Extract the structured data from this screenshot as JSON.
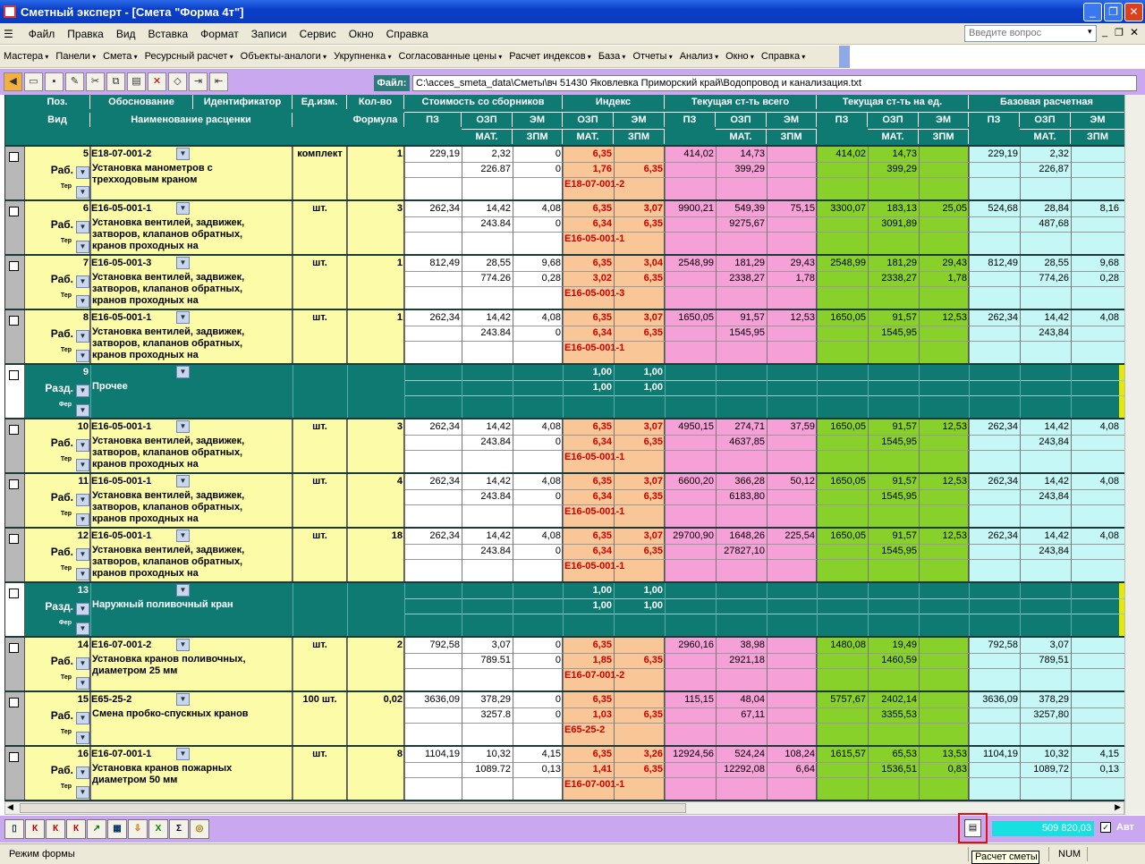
{
  "title": "Сметный эксперт - [Смета \"Форма 4т\"]",
  "menu": [
    "Файл",
    "Правка",
    "Вид",
    "Вставка",
    "Формат",
    "Записи",
    "Сервис",
    "Окно",
    "Справка"
  ],
  "ask_placeholder": "Введите вопрос",
  "toolbar2": [
    "Мастера",
    "Панели",
    "Смета",
    "Ресурсный расчет",
    "Объекты-аналоги",
    "Укрупненка",
    "Согласованные цены",
    "Расчет индексов",
    "База",
    "Отчеты",
    "Анализ",
    "Окно",
    "Справка"
  ],
  "file_label": "Файл:",
  "file_path": "C:\\acces_smeta_data\\Сметы\\вч 51430 Яковлевка Приморский край\\Водопровод и канализация.txt",
  "header": {
    "pos": "Поз.",
    "vid": "Вид",
    "obosn": "Обоснование",
    "ident": "Идентификатор",
    "name": "Наименование расценки",
    "unit": "Ед.изм.",
    "qty": "Кол-во",
    "formula": "Формула",
    "g1": "Стоимость со сборников",
    "g2": "Индекс",
    "g3": "Текущая ст-ть всего",
    "g4": "Текущая ст-ть на ед.",
    "g5": "Базовая расчетная",
    "pz": "ПЗ",
    "ozp": "ОЗП",
    "em": "ЭМ",
    "mat": "МАТ.",
    "zpm": "ЗПМ"
  },
  "rows": [
    {
      "type": "rab",
      "pos": "5",
      "code": "Е18-07-001-2",
      "vid": "Раб.",
      "name": [
        "Установка манометров с",
        "трехходовым краном"
      ],
      "unit": "комплект",
      "qty": "1",
      "s": [
        "229,19",
        "2,32",
        "0",
        "226.87",
        "0"
      ],
      "i": [
        "6,35",
        "",
        "1,76",
        "6,35"
      ],
      "icode": "Е18-07-001-2",
      "t": [
        "414,02",
        "14,73",
        "",
        "399,29",
        ""
      ],
      "u": [
        "414,02",
        "14,73",
        "",
        "399,29",
        ""
      ],
      "bz": [
        "229,19",
        "2,32",
        "",
        "226,87",
        ""
      ]
    },
    {
      "type": "rab",
      "pos": "6",
      "code": "Е16-05-001-1",
      "vid": "Раб.",
      "name": [
        "Установка вентилей, задвижек,",
        "затворов, клапанов обратных,",
        "кранов проходных на"
      ],
      "unit": "шт.",
      "qty": "3",
      "s": [
        "262,34",
        "14,42",
        "4,08",
        "243.84",
        "0"
      ],
      "i": [
        "6,35",
        "3,07",
        "6,34",
        "6,35"
      ],
      "icode": "Е16-05-001-1",
      "t": [
        "9900,21",
        "549,39",
        "75,15",
        "9275,67",
        ""
      ],
      "u": [
        "3300,07",
        "183,13",
        "25,05",
        "3091,89",
        ""
      ],
      "bz": [
        "524,68",
        "28,84",
        "8,16",
        "487,68",
        ""
      ]
    },
    {
      "type": "rab",
      "pos": "7",
      "code": "Е16-05-001-3",
      "vid": "Раб.",
      "name": [
        "Установка вентилей, задвижек,",
        "затворов, клапанов обратных,",
        "кранов проходных на"
      ],
      "unit": "шт.",
      "qty": "1",
      "s": [
        "812,49",
        "28,55",
        "9,68",
        "774.26",
        "0,28"
      ],
      "i": [
        "6,35",
        "3,04",
        "3,02",
        "6,35"
      ],
      "icode": "Е16-05-001-3",
      "t": [
        "2548,99",
        "181,29",
        "29,43",
        "2338,27",
        "1,78"
      ],
      "u": [
        "2548,99",
        "181,29",
        "29,43",
        "2338,27",
        "1,78"
      ],
      "bz": [
        "812,49",
        "28,55",
        "9,68",
        "774,26",
        "0,28"
      ]
    },
    {
      "type": "rab",
      "pos": "8",
      "code": "Е16-05-001-1",
      "vid": "Раб.",
      "name": [
        "Установка вентилей, задвижек,",
        "затворов, клапанов обратных,",
        "кранов проходных на"
      ],
      "unit": "шт.",
      "qty": "1",
      "s": [
        "262,34",
        "14,42",
        "4,08",
        "243.84",
        "0"
      ],
      "i": [
        "6,35",
        "3,07",
        "6,34",
        "6,35"
      ],
      "icode": "Е16-05-001-1",
      "t": [
        "1650,05",
        "91,57",
        "12,53",
        "1545,95",
        ""
      ],
      "u": [
        "1650,05",
        "91,57",
        "12,53",
        "1545,95",
        ""
      ],
      "bz": [
        "262,34",
        "14,42",
        "4,08",
        "243,84",
        ""
      ]
    },
    {
      "type": "sec",
      "pos": "9",
      "vid": "Разд.",
      "name": [
        "Прочее"
      ],
      "i": [
        "1,00",
        "1,00",
        "1,00",
        "1,00"
      ]
    },
    {
      "type": "rab",
      "pos": "10",
      "code": "Е16-05-001-1",
      "vid": "Раб.",
      "name": [
        "Установка вентилей, задвижек,",
        "затворов, клапанов обратных,",
        "кранов проходных на"
      ],
      "unit": "шт.",
      "qty": "3",
      "s": [
        "262,34",
        "14,42",
        "4,08",
        "243.84",
        "0"
      ],
      "i": [
        "6,35",
        "3,07",
        "6,34",
        "6,35"
      ],
      "icode": "Е16-05-001-1",
      "t": [
        "4950,15",
        "274,71",
        "37,59",
        "4637,85",
        ""
      ],
      "u": [
        "1650,05",
        "91,57",
        "12,53",
        "1545,95",
        ""
      ],
      "bz": [
        "262,34",
        "14,42",
        "4,08",
        "243,84",
        ""
      ]
    },
    {
      "type": "rab",
      "pos": "11",
      "code": "Е16-05-001-1",
      "vid": "Раб.",
      "name": [
        "Установка вентилей, задвижек,",
        "затворов, клапанов обратных,",
        "кранов проходных на"
      ],
      "unit": "шт.",
      "qty": "4",
      "s": [
        "262,34",
        "14,42",
        "4,08",
        "243.84",
        "0"
      ],
      "i": [
        "6,35",
        "3,07",
        "6,34",
        "6,35"
      ],
      "icode": "Е16-05-001-1",
      "t": [
        "6600,20",
        "366,28",
        "50,12",
        "6183,80",
        ""
      ],
      "u": [
        "1650,05",
        "91,57",
        "12,53",
        "1545,95",
        ""
      ],
      "bz": [
        "262,34",
        "14,42",
        "4,08",
        "243,84",
        ""
      ]
    },
    {
      "type": "rab",
      "pos": "12",
      "code": "Е16-05-001-1",
      "vid": "Раб.",
      "name": [
        "Установка вентилей, задвижек,",
        "затворов, клапанов обратных,",
        "кранов проходных на"
      ],
      "unit": "шт.",
      "qty": "18",
      "s": [
        "262,34",
        "14,42",
        "4,08",
        "243.84",
        "0"
      ],
      "i": [
        "6,35",
        "3,07",
        "6,34",
        "6,35"
      ],
      "icode": "Е16-05-001-1",
      "t": [
        "29700,90",
        "1648,26",
        "225,54",
        "27827,10",
        ""
      ],
      "u": [
        "1650,05",
        "91,57",
        "12,53",
        "1545,95",
        ""
      ],
      "bz": [
        "262,34",
        "14,42",
        "4,08",
        "243,84",
        ""
      ]
    },
    {
      "type": "sec",
      "pos": "13",
      "vid": "Разд.",
      "name": [
        "Наружный поливочный кран"
      ],
      "i": [
        "1,00",
        "1,00",
        "1,00",
        "1,00"
      ]
    },
    {
      "type": "rab",
      "pos": "14",
      "code": "Е16-07-001-2",
      "vid": "Раб.",
      "name": [
        "Установка кранов поливочных,",
        "диаметром 25 мм"
      ],
      "unit": "шт.",
      "qty": "2",
      "s": [
        "792,58",
        "3,07",
        "0",
        "789.51",
        "0"
      ],
      "i": [
        "6,35",
        "",
        "1,85",
        "6,35"
      ],
      "icode": "Е16-07-001-2",
      "t": [
        "2960,16",
        "38,98",
        "",
        "2921,18",
        ""
      ],
      "u": [
        "1480,08",
        "19,49",
        "",
        "1460,59",
        ""
      ],
      "bz": [
        "792,58",
        "3,07",
        "",
        "789,51",
        ""
      ]
    },
    {
      "type": "rab",
      "pos": "15",
      "code": "Е65-25-2",
      "vid": "Раб.",
      "name": [
        "Смена пробко-спускных кранов"
      ],
      "unit": "100 шт.",
      "qty": "0,02",
      "s": [
        "3636,09",
        "378,29",
        "0",
        "3257.8",
        "0"
      ],
      "i": [
        "6,35",
        "",
        "1,03",
        "6,35"
      ],
      "icode": "Е65-25-2",
      "t": [
        "115,15",
        "48,04",
        "",
        "67,11",
        ""
      ],
      "u": [
        "5757,67",
        "2402,14",
        "",
        "3355,53",
        ""
      ],
      "bz": [
        "3636,09",
        "378,29",
        "",
        "3257,80",
        ""
      ]
    },
    {
      "type": "rab",
      "pos": "16",
      "code": "Е16-07-001-1",
      "vid": "Раб.",
      "name": [
        "Установка кранов пожарных",
        "диаметром 50 мм"
      ],
      "unit": "шт.",
      "qty": "8",
      "s": [
        "1104,19",
        "10,32",
        "4,15",
        "1089.72",
        "0,13"
      ],
      "i": [
        "6,35",
        "3,26",
        "1,41",
        "6,35"
      ],
      "icode": "Е16-07-001-1",
      "t": [
        "12924,56",
        "524,24",
        "108,24",
        "12292,08",
        "6,64"
      ],
      "u": [
        "1615,57",
        "65,53",
        "13,53",
        "1536,51",
        "0,83"
      ],
      "bz": [
        "1104,19",
        "10,32",
        "4,15",
        "1089,72",
        "0,13"
      ]
    }
  ],
  "small_labels": {
    "ter": "Тер",
    "fer": "Фер"
  },
  "total": "509 820,03",
  "avt": "Авт",
  "status": "Режим формы",
  "num": "NUM",
  "tooltip": "Расчет сметы",
  "colors": {
    "yellow": "#fbfba8",
    "pink": "#f6a0d8",
    "green": "#88d12a",
    "cyan": "#c6f7f7",
    "peach": "#f9c698",
    "teal": "#0f7a72",
    "lavender": "#c9a8f0"
  }
}
